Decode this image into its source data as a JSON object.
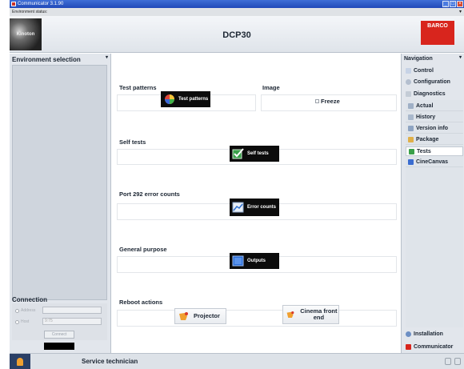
{
  "window": {
    "title": "Communicator 3.1.90"
  },
  "env_status": "Environment status:",
  "header": {
    "title": "DCP30",
    "left_logo": "Kinoton",
    "right_logo": "BARCO"
  },
  "left_panel": {
    "environment_title": "Environment selection",
    "connection_title": "Connection",
    "radio_1": "Address",
    "radio_2": "Host",
    "address_value": "",
    "host_value": "9:75",
    "connect_label": "Connect"
  },
  "main": {
    "test_patterns": {
      "heading": "Test patterns",
      "button": "Test patterns"
    },
    "image": {
      "heading": "Image",
      "freeze_label": "Freeze",
      "freeze_checked": false
    },
    "self_tests": {
      "heading": "Self tests",
      "button": "Self tests"
    },
    "port_292": {
      "heading": "Port 292 error counts",
      "button": "Error counts"
    },
    "general_purpose": {
      "heading": "General purpose",
      "button": "Outputs"
    },
    "reboot": {
      "heading": "Reboot actions",
      "projector": "Projector",
      "cinema": "Cinema front end"
    }
  },
  "navigation": {
    "title": "Navigation",
    "items": [
      {
        "label": "Control",
        "icon": "control-icon"
      },
      {
        "label": "Configuration",
        "icon": "configuration-icon"
      },
      {
        "label": "Diagnostics",
        "icon": "diagnostics-icon"
      }
    ],
    "sub_items": [
      {
        "label": "Actual",
        "icon": "actual-icon"
      },
      {
        "label": "History",
        "icon": "history-icon"
      },
      {
        "label": "Version info",
        "icon": "version-info-icon"
      },
      {
        "label": "Package",
        "icon": "package-icon"
      },
      {
        "label": "Tests",
        "icon": "tests-icon",
        "active": true
      },
      {
        "label": "CineCanvas",
        "icon": "cinecanvas-icon"
      }
    ],
    "bottom_items": [
      {
        "label": "Installation",
        "icon": "installation-icon"
      },
      {
        "label": "Communicator",
        "icon": "communicator-icon"
      }
    ]
  },
  "statusbar": {
    "user_role": "Service technician"
  },
  "colors": {
    "accent_red": "#d8251d",
    "title_blue": "#2048b8",
    "button_black": "#0c0c0c"
  }
}
